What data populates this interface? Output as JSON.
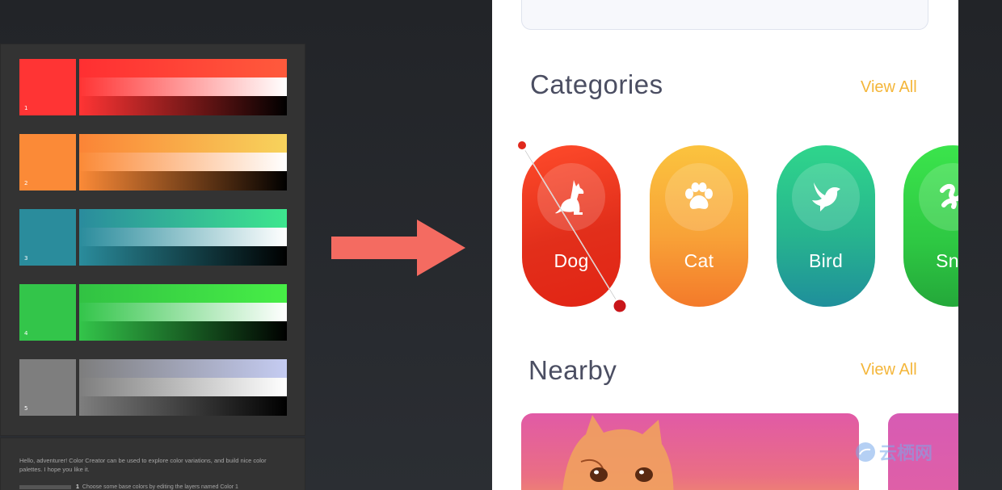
{
  "palette": {
    "rows": [
      {
        "num": "1",
        "base": "#ff3434",
        "top": [
          "#ff2f32",
          "#ff5a3c"
        ]
      },
      {
        "num": "2",
        "base": "#fb8a37",
        "top": [
          "#fb8436",
          "#f7d35c"
        ]
      },
      {
        "num": "3",
        "base": "#2a8c9c",
        "top": [
          "#2a8b9d",
          "#3de68e"
        ]
      },
      {
        "num": "4",
        "base": "#33c54a",
        "top": [
          "#31c243",
          "#47ee46"
        ]
      },
      {
        "num": "5",
        "base": "#7e7e7e",
        "top": [
          "#7d7d7d",
          "#c5ccf2"
        ]
      }
    ],
    "notes": "Hello, adventurer! Color Creator can be used to explore color variations, and build nice color palettes. I hope you like it.",
    "step_index": "1",
    "step_text": "Choose some base colors by editing the layers named Color 1"
  },
  "app": {
    "categories_title": "Categories",
    "categories_view_all": "View All",
    "categories": [
      {
        "label": "Dog",
        "icon": "dog-icon"
      },
      {
        "label": "Cat",
        "icon": "paw-icon"
      },
      {
        "label": "Bird",
        "icon": "bird-icon"
      },
      {
        "label": "Sna",
        "icon": "snake-icon"
      }
    ],
    "nearby_title": "Nearby",
    "nearby_view_all": "View All"
  },
  "watermark": "云栖网",
  "colors": {
    "arrow": "#f46b61",
    "accent": "#f4b63a",
    "title_text": "#4b4e62",
    "gradient_handle": "#e0281c"
  }
}
